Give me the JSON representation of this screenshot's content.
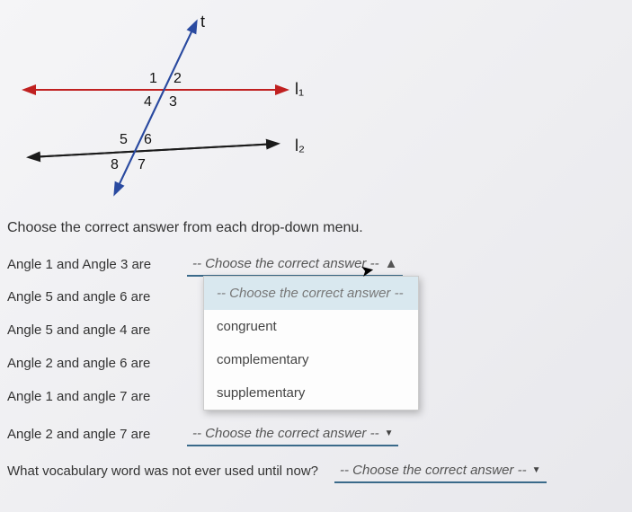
{
  "diagram": {
    "transversal_label": "t",
    "line1_label": "l₁",
    "line2_label": "l₂",
    "angles": [
      "1",
      "2",
      "3",
      "4",
      "5",
      "6",
      "7",
      "8"
    ]
  },
  "instruction": "Choose the correct answer from each drop-down menu.",
  "rows": [
    {
      "label": "Angle 1 and Angle 3 are",
      "state": "open"
    },
    {
      "label": "Angle 5 and angle 6 are"
    },
    {
      "label": "Angle 5 and angle 4 are"
    },
    {
      "label": "Angle 2 and angle 6 are"
    },
    {
      "label": "Angle 1 and angle 7 are"
    },
    {
      "label": "Angle 2 and angle 7 are"
    }
  ],
  "last_question": "What vocabulary word was not ever used until now?",
  "dropdown": {
    "placeholder_open": "-- Choose the correct answer --",
    "placeholder_closed": "-- Choose the correct answer --",
    "options": [
      "congruent",
      "complementary",
      "supplementary"
    ],
    "caret_up": "▲",
    "caret_down": "▼"
  }
}
